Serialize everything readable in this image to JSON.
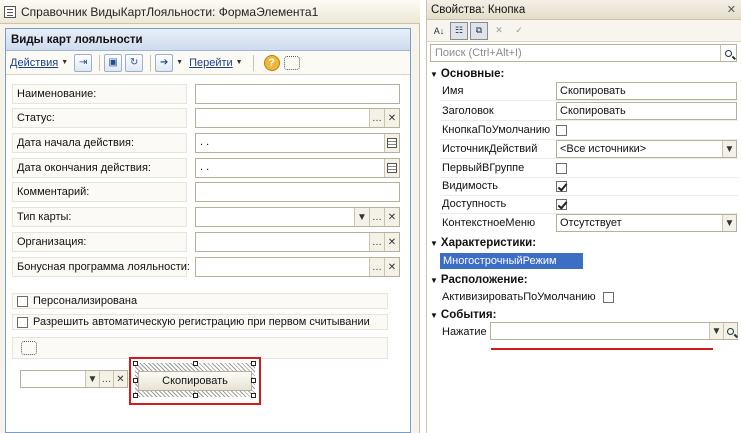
{
  "left_window": {
    "title": "Справочник ВидыКартЛояльности: ФормаЭлемента1",
    "form_title": "Виды карт лояльности",
    "toolbar": {
      "actions": "Действия",
      "go": "Перейти",
      "help": "?"
    },
    "fields": [
      {
        "label": "Наименование:",
        "value": "",
        "type": "text"
      },
      {
        "label": "Статус:",
        "value": "",
        "type": "ref"
      },
      {
        "label": "Дата начала действия:",
        "value": " .  .",
        "type": "date"
      },
      {
        "label": "Дата окончания действия:",
        "value": " .  .",
        "type": "date"
      },
      {
        "label": "Комментарий:",
        "value": "",
        "type": "text"
      },
      {
        "label": "Тип карты:",
        "value": "",
        "type": "combo"
      },
      {
        "label": "Организация:",
        "value": "",
        "type": "ref"
      },
      {
        "label": "Бонусная программа лояльности:",
        "value": "",
        "type": "ref"
      }
    ],
    "checkboxes": [
      {
        "label": "Персонализирована",
        "checked": false
      },
      {
        "label": "Разрешить автоматическую регистрацию при первом считывании",
        "checked": false
      }
    ],
    "copy_button": "Скопировать"
  },
  "right_panel": {
    "title": "Свойства: Кнопка",
    "search_placeholder": "Поиск (Ctrl+Alt+I)",
    "groups": {
      "main": "Основные:",
      "characteristics": "Характеристики:",
      "layout": "Расположение:",
      "events": "События:"
    },
    "props": {
      "name_label": "Имя",
      "name_value": "Скопировать",
      "caption_label": "Заголовок",
      "caption_value": "Скопировать",
      "default_label": "КнопкаПоУмолчанию",
      "source_label": "ИсточникДействий",
      "source_value": "<Все источники>",
      "first_label": "ПервыйВГруппе",
      "visible_label": "Видимость",
      "enabled_label": "Доступность",
      "context_label": "КонтекстноеМеню",
      "context_value": "Отсутствует",
      "multiline_label": "МногострочныйРежим",
      "activate_label": "АктивизироватьПоУмолчанию",
      "press_label": "Нажатие"
    }
  }
}
